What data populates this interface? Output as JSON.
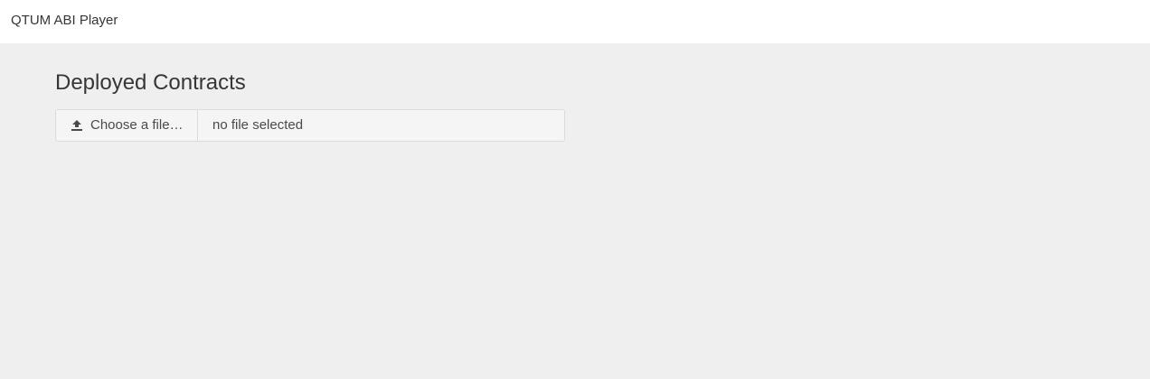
{
  "navbar": {
    "brand": "QTUM ABI Player"
  },
  "main": {
    "title": "Deployed Contracts",
    "file_picker": {
      "button_label": "Choose a file…",
      "button_icon": "upload-icon",
      "file_name": "no file selected"
    }
  }
}
